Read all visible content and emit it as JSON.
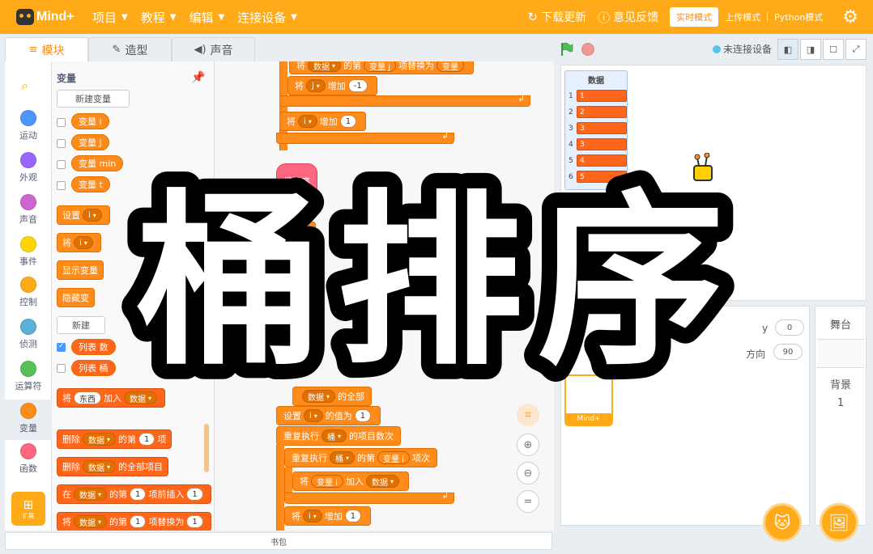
{
  "app": {
    "logo_text": "Mind+"
  },
  "menu": [
    {
      "label": "项目"
    },
    {
      "label": "教程"
    },
    {
      "label": "编辑"
    },
    {
      "label": "连接设备"
    }
  ],
  "top_right": {
    "download": "下载更新",
    "feedback": "意见反馈",
    "modes": [
      "实时模式",
      "上传模式",
      "Python模式"
    ],
    "active_mode": "实时模式"
  },
  "tabs": [
    {
      "label": "模块",
      "icon": "blocks-icon"
    },
    {
      "label": "造型",
      "icon": "brush-icon"
    },
    {
      "label": "声音",
      "icon": "speaker-icon"
    }
  ],
  "connection": "未连接设备",
  "categories": [
    {
      "label": "运动",
      "color": "#4c97ff"
    },
    {
      "label": "外观",
      "color": "#9966ff"
    },
    {
      "label": "声音",
      "color": "#cf63cf"
    },
    {
      "label": "事件",
      "color": "#ffd500"
    },
    {
      "label": "控制",
      "color": "#ffab19"
    },
    {
      "label": "侦测",
      "color": "#5cb1d6"
    },
    {
      "label": "运算符",
      "color": "#59c059"
    },
    {
      "label": "变量",
      "color": "#ff8c1a"
    },
    {
      "label": "函数",
      "color": "#ff6680"
    }
  ],
  "extension": "扩展",
  "palette": {
    "title": "变量",
    "new_variable": "新建变量",
    "variables": [
      "变量 i",
      "变量 j",
      "变量 min",
      "变量 t"
    ],
    "set_block": {
      "a": "设置",
      "v": "i"
    },
    "change_block": {
      "a": "将",
      "v": "i"
    },
    "show_var": "显示变量",
    "hide_var": "隐藏变",
    "new_list": "新建",
    "lists": [
      "列表 数",
      "列表 桶"
    ],
    "add_block": {
      "a": "将",
      "item": "东西",
      "b": "加入",
      "list": "数据"
    },
    "delete_block": {
      "a": "删除",
      "list": "数据",
      "b": "的第",
      "n": "1",
      "c": "项"
    },
    "delete_all_block": {
      "a": "删除",
      "list": "数据",
      "b": "的全部项目"
    },
    "insert_block": {
      "a": "在",
      "list": "数据",
      "b": "的第",
      "n": "1",
      "c": "项前插入",
      "d": "1"
    },
    "replace_block": {
      "a": "将",
      "list": "数据",
      "b": "的第",
      "n": "1",
      "c": "项替换为",
      "d": "1"
    }
  },
  "code": {
    "top_partial": {
      "a": "将",
      "b": "数据",
      "c": "的第",
      "d": "变量 j",
      "e": "项替换为",
      "f": "变量"
    },
    "change_j": {
      "a": "将",
      "v": "j",
      "b": "增加",
      "n": "-1"
    },
    "change_i": {
      "a": "将",
      "v": "i",
      "b": "增加",
      "n": "1"
    },
    "func_def": "桶排序",
    "partial_1": "行",
    "clear_block": {
      "list": "数据",
      "b": "的全部"
    },
    "set_i": {
      "a": "设置",
      "v": "i",
      "b": "的值为",
      "n": "1"
    },
    "repeat_outer": {
      "a": "重复执行",
      "list": "桶",
      "b": "的项目数",
      "c": "次"
    },
    "repeat_inner": {
      "a": "重复执行",
      "list": "桶",
      "b": "的第",
      "v": "变量 i",
      "c": "项",
      "d": "次"
    },
    "add_i": {
      "a": "将",
      "v": "变量 i",
      "b": "加入",
      "list": "数据"
    },
    "change_i2": {
      "a": "将",
      "v": "i",
      "b": "增加",
      "n": "1"
    }
  },
  "backpack": "书包",
  "stage": {
    "list_title": "数据",
    "list_items": [
      {
        "index": "1",
        "value": "1"
      },
      {
        "index": "2",
        "value": "2"
      },
      {
        "index": "3",
        "value": "3"
      },
      {
        "index": "4",
        "value": "3"
      },
      {
        "index": "5",
        "value": "4"
      },
      {
        "index": "6",
        "value": "5"
      }
    ]
  },
  "sprite_panel": {
    "y_partial": "y",
    "y_value": "0",
    "direction_label": "方向",
    "direction_value": "90",
    "sprite_name": "Mind+"
  },
  "stage_panel": {
    "title": "舞台",
    "backdrop_label": "背景",
    "backdrop_count": "1"
  },
  "overlay_title": "桶排序"
}
